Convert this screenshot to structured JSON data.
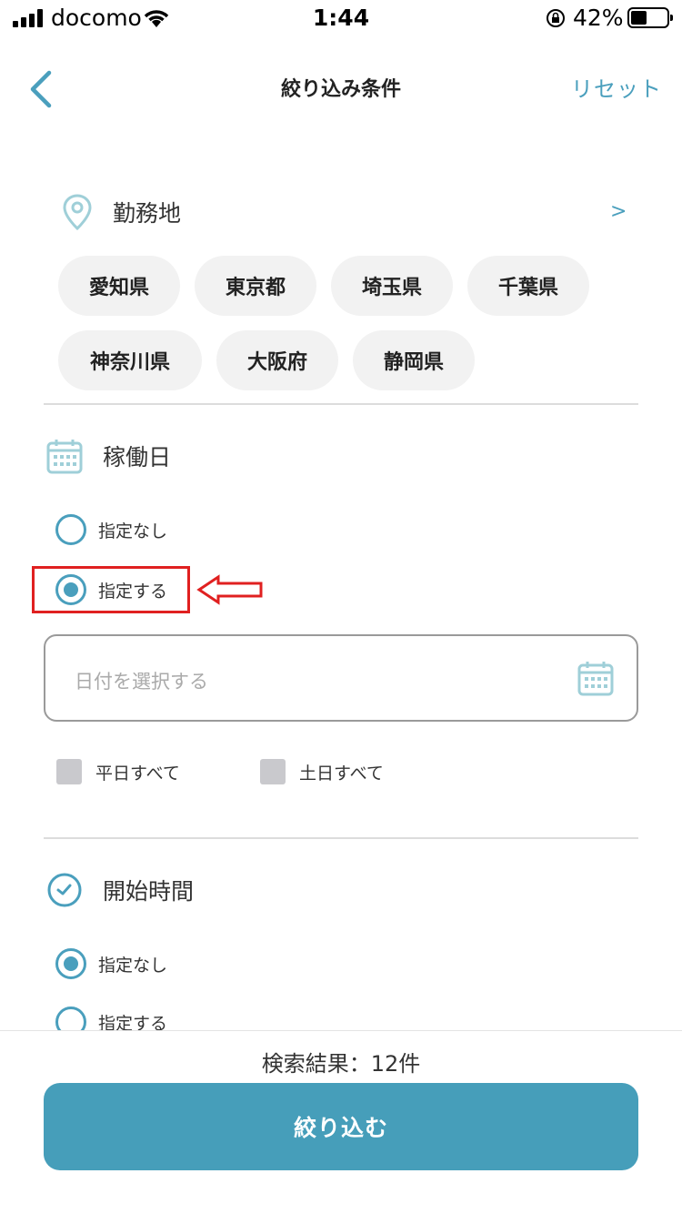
{
  "status_bar": {
    "carrier": "docomo",
    "time": "1:44",
    "battery": "42%"
  },
  "nav": {
    "title": "絞り込み条件",
    "reset": "リセット"
  },
  "location": {
    "title": "勤務地",
    "chevron": ">",
    "prefectures": [
      "愛知県",
      "東京都",
      "埼玉県",
      "千葉県",
      "神奈川県",
      "大阪府",
      "静岡県"
    ]
  },
  "workday": {
    "title": "稼働日",
    "option_none": "指定なし",
    "option_specify": "指定する",
    "selected": "指定する",
    "date_placeholder": "日付を選択する",
    "weekdays_all": "平日すべて",
    "weekends_all": "土日すべて"
  },
  "start_time": {
    "title": "開始時間",
    "option_none": "指定なし",
    "option_specify": "指定する",
    "selected": "指定なし"
  },
  "footer": {
    "result_count": "検索結果：12件",
    "submit": "絞り込む"
  },
  "colors": {
    "accent": "#469eba",
    "highlight": "#e02020",
    "chip_bg": "#f2f2f2"
  }
}
